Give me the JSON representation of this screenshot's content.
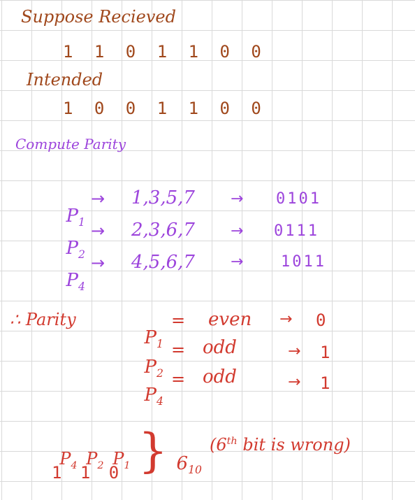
{
  "received": {
    "heading": "Suppose Recieved",
    "bits": "1 1 0 1 1 0 0"
  },
  "intended": {
    "heading": "Intended",
    "bits": "1 0 0 1 1 0 0"
  },
  "compute": {
    "heading": "Compute Parity",
    "rows": [
      {
        "p": "P",
        "sub": "1",
        "arrow": "→",
        "positions": "1,3,5,7",
        "arrow2": "→",
        "bits": "0101"
      },
      {
        "p": "P",
        "sub": "2",
        "arrow": "→",
        "positions": "2,3,6,7",
        "arrow2": "→",
        "bits": "0111"
      },
      {
        "p": "P",
        "sub": "4",
        "arrow": "→",
        "positions": "4,5,6,7",
        "arrow2": "→",
        "bits": "1011"
      }
    ]
  },
  "parity": {
    "prefix": "∴ Parity",
    "rows": [
      {
        "p": "P",
        "sub": "1",
        "eq": "=",
        "value": "even",
        "arrow": "→",
        "bit": "0"
      },
      {
        "p": "P",
        "sub": "2",
        "eq": "=",
        "value": "odd",
        "arrow": "→",
        "bit": "1"
      },
      {
        "p": "P",
        "sub": "4",
        "eq": "=",
        "value": "odd",
        "arrow": "→",
        "bit": "1"
      }
    ]
  },
  "result": {
    "labels": [
      {
        "p": "P",
        "sub": "4"
      },
      {
        "p": "P",
        "sub": "2"
      },
      {
        "p": "P",
        "sub": "1"
      }
    ],
    "bits": "1 1 0",
    "decimal": "6",
    "decimal_sub": "10",
    "note_open": "(6",
    "note_sup": "th",
    "note_rest": " bit is wrong)"
  },
  "colors": {
    "brown": "#a0481c",
    "purple": "#9c44dc",
    "red": "#d23a2f",
    "grid": "#d9d9d9"
  }
}
